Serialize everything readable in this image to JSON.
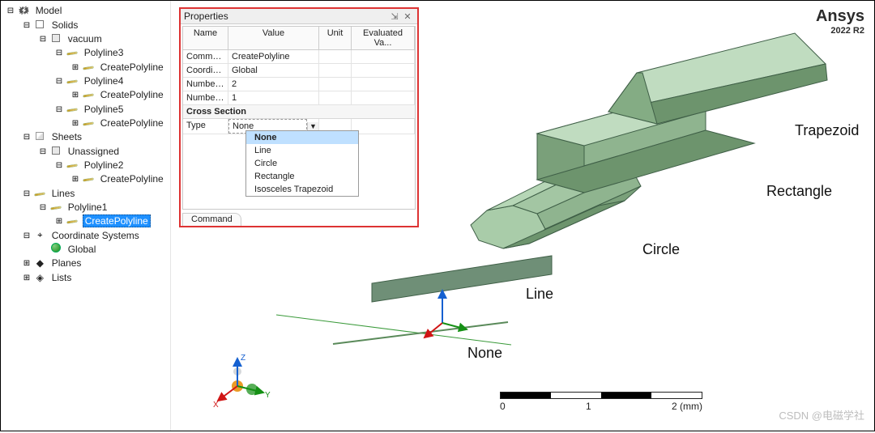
{
  "tree": {
    "root": "Model",
    "solids": "Solids",
    "vacuum": "vacuum",
    "p3": "Polyline3",
    "p4": "Polyline4",
    "p5": "Polyline5",
    "cp": "CreatePolyline",
    "sheets": "Sheets",
    "unassigned": "Unassigned",
    "p2": "Polyline2",
    "lines": "Lines",
    "p1": "Polyline1",
    "csys": "Coordinate Systems",
    "global": "Global",
    "planes": "Planes",
    "lists": "Lists"
  },
  "panel": {
    "title": "Properties",
    "hdr": {
      "name": "Name",
      "value": "Value",
      "unit": "Unit",
      "eval": "Evaluated Va..."
    },
    "rows": {
      "r1n": "Command",
      "r1v": "CreatePolyline",
      "r2n": "Coordin...",
      "r2v": "Global",
      "r3n": "Number...",
      "r3v": "2",
      "r4n": "Number...",
      "r4v": "1"
    },
    "section": "Cross Section",
    "type_label": "Type",
    "type_value": "None",
    "dropdown": [
      "None",
      "Line",
      "Circle",
      "Rectangle",
      "Isosceles Trapezoid"
    ],
    "tab": "Command"
  },
  "labels": {
    "none": "None",
    "line": "Line",
    "circle": "Circle",
    "rect": "Rectangle",
    "trap": "Trapezoid"
  },
  "axis": {
    "x": "X",
    "y": "Y",
    "z": "Z"
  },
  "scale": {
    "0": "0",
    "1": "1",
    "2": "2 (mm)"
  },
  "logo": {
    "name": "Ansys",
    "ver": "2022 R2"
  },
  "watermark": "CSDN @电磁学社"
}
